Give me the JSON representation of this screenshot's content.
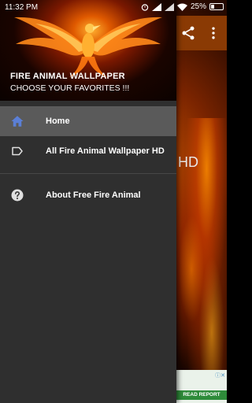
{
  "status_bar": {
    "time": "11:32 PM",
    "battery": "25%"
  },
  "background_app": {
    "visible_title_fragment": "er HD",
    "ad_choices": "ⓘ✕",
    "ad_button": "READ REPORT"
  },
  "drawer": {
    "header": {
      "title": "FIRE ANIMAL WALLPAPER",
      "subtitle": "CHOOSE YOUR FAVORITES !!!"
    },
    "items": [
      {
        "label": "Home",
        "icon": "home-icon",
        "selected": true
      },
      {
        "label": "All Fire Animal Wallpaper HD",
        "icon": "label-tag-icon",
        "selected": false
      }
    ],
    "secondary_items": [
      {
        "label": "About Free Fire Animal",
        "icon": "help-icon"
      }
    ]
  },
  "colors": {
    "drawer_bg": "#2f2f2f",
    "selected_bg": "#5a5a5a",
    "home_icon": "#5b7fd6",
    "toolbar": "#8a3a04"
  }
}
